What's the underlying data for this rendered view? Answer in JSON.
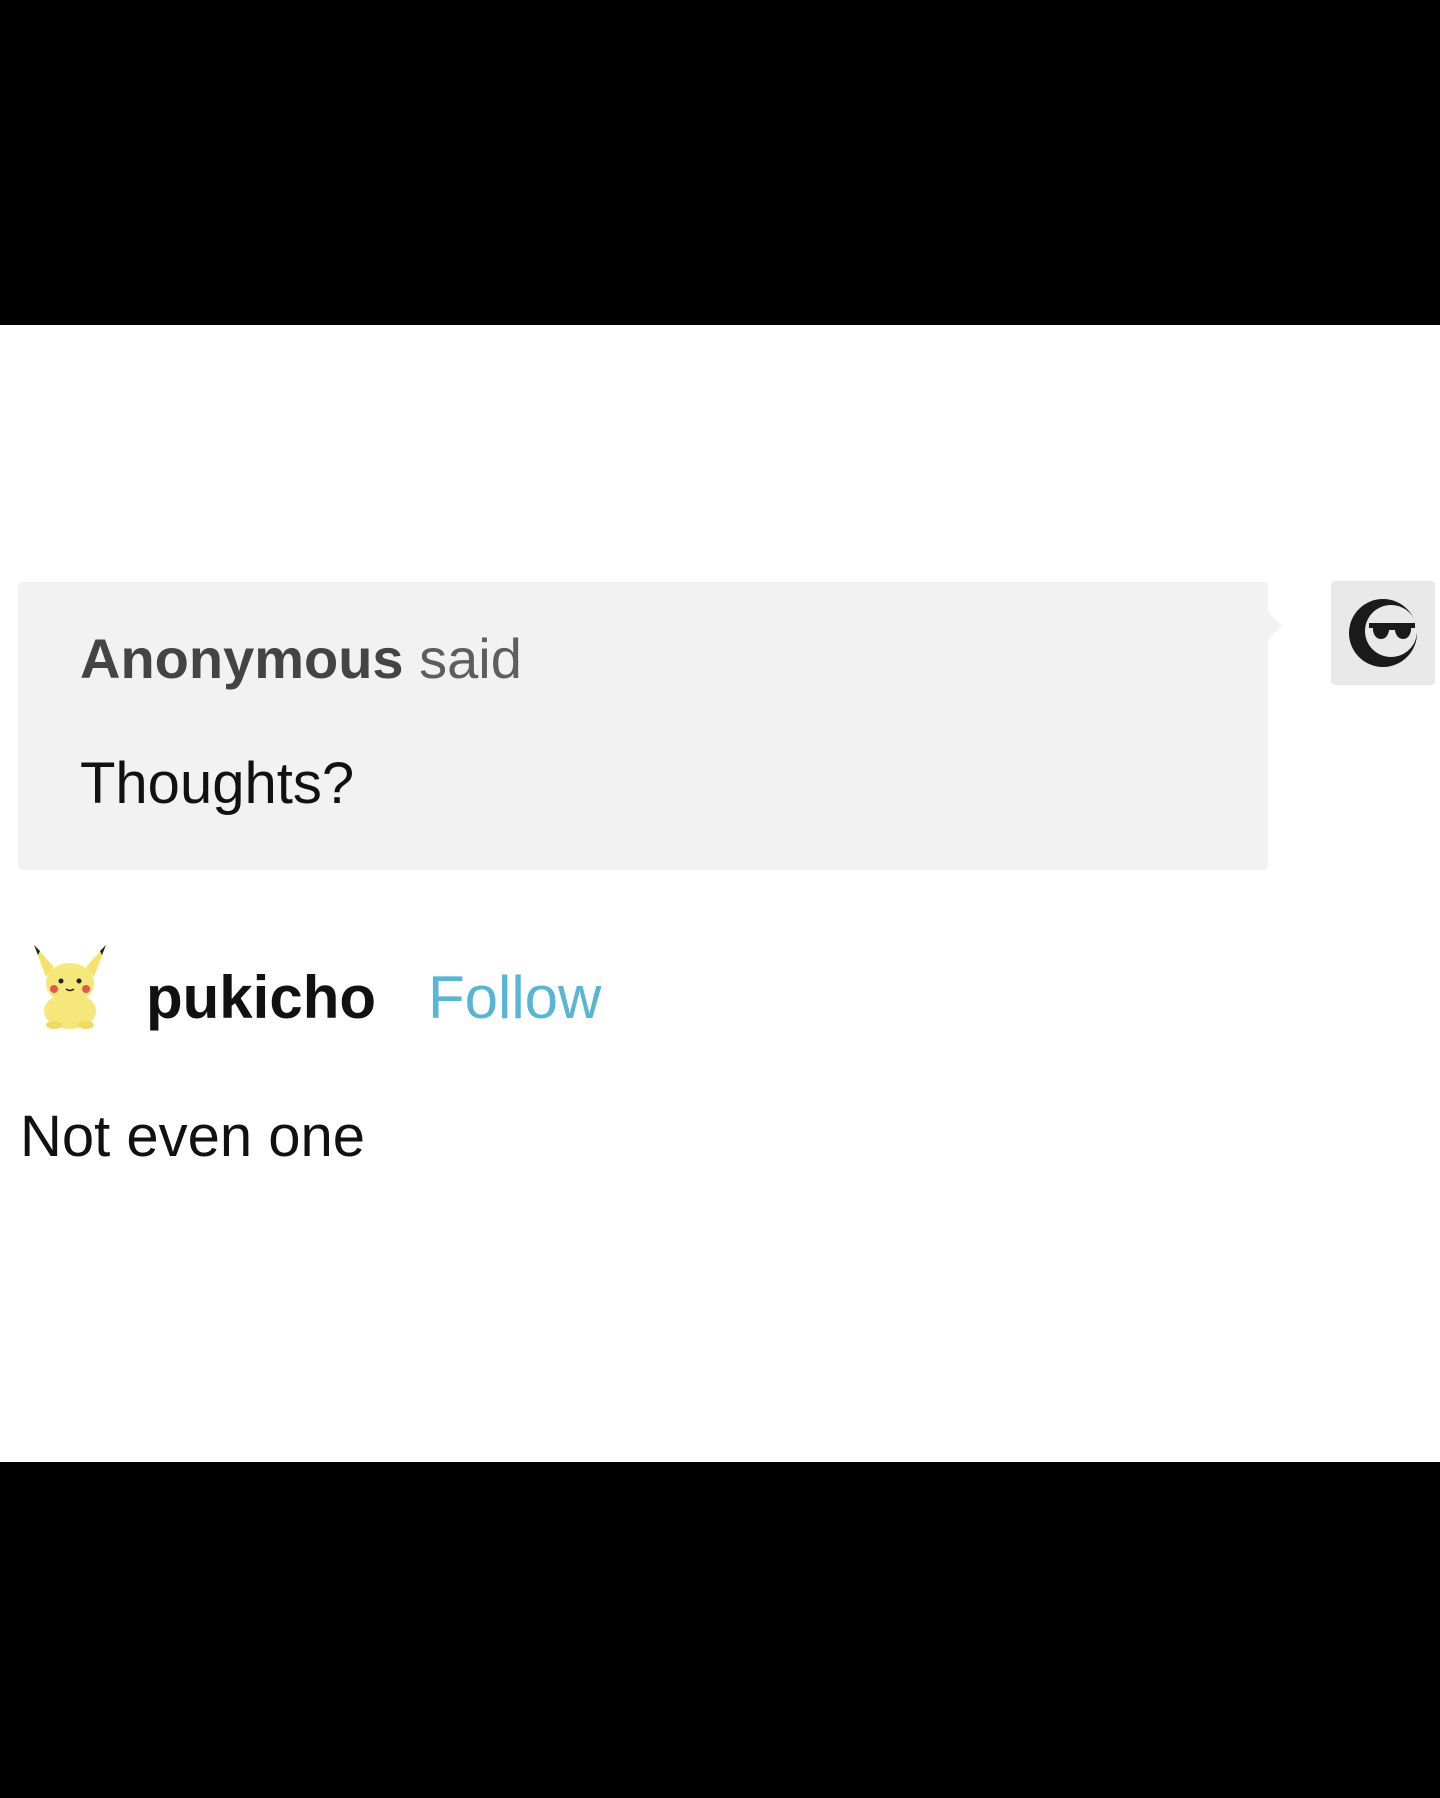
{
  "ask": {
    "asker_name": "Anonymous",
    "asker_verb": "said",
    "question": "Thoughts?",
    "asker_avatar_icon": "anonymous-sunglasses-icon"
  },
  "reply": {
    "username": "pukicho",
    "follow_label": "Follow",
    "avatar_icon": "pikachu-avatar-icon",
    "answer": "Not even one"
  },
  "colors": {
    "bubble_bg": "#f2f2f2",
    "follow_link": "#59b5d4",
    "letterbox": "#000000"
  }
}
